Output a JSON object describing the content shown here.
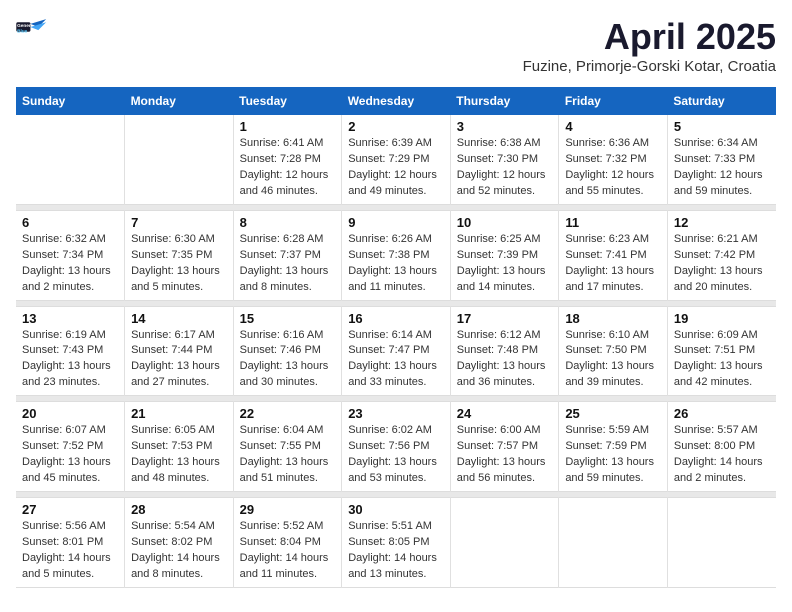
{
  "logo": {
    "line1": "General",
    "line2": "Blue"
  },
  "title": "April 2025",
  "subtitle": "Fuzine, Primorje-Gorski Kotar, Croatia",
  "days_of_week": [
    "Sunday",
    "Monday",
    "Tuesday",
    "Wednesday",
    "Thursday",
    "Friday",
    "Saturday"
  ],
  "weeks": [
    {
      "cells": [
        {
          "day": "",
          "content": ""
        },
        {
          "day": "",
          "content": ""
        },
        {
          "day": "1",
          "content": "Sunrise: 6:41 AM\nSunset: 7:28 PM\nDaylight: 12 hours\nand 46 minutes."
        },
        {
          "day": "2",
          "content": "Sunrise: 6:39 AM\nSunset: 7:29 PM\nDaylight: 12 hours\nand 49 minutes."
        },
        {
          "day": "3",
          "content": "Sunrise: 6:38 AM\nSunset: 7:30 PM\nDaylight: 12 hours\nand 52 minutes."
        },
        {
          "day": "4",
          "content": "Sunrise: 6:36 AM\nSunset: 7:32 PM\nDaylight: 12 hours\nand 55 minutes."
        },
        {
          "day": "5",
          "content": "Sunrise: 6:34 AM\nSunset: 7:33 PM\nDaylight: 12 hours\nand 59 minutes."
        }
      ]
    },
    {
      "cells": [
        {
          "day": "6",
          "content": "Sunrise: 6:32 AM\nSunset: 7:34 PM\nDaylight: 13 hours\nand 2 minutes."
        },
        {
          "day": "7",
          "content": "Sunrise: 6:30 AM\nSunset: 7:35 PM\nDaylight: 13 hours\nand 5 minutes."
        },
        {
          "day": "8",
          "content": "Sunrise: 6:28 AM\nSunset: 7:37 PM\nDaylight: 13 hours\nand 8 minutes."
        },
        {
          "day": "9",
          "content": "Sunrise: 6:26 AM\nSunset: 7:38 PM\nDaylight: 13 hours\nand 11 minutes."
        },
        {
          "day": "10",
          "content": "Sunrise: 6:25 AM\nSunset: 7:39 PM\nDaylight: 13 hours\nand 14 minutes."
        },
        {
          "day": "11",
          "content": "Sunrise: 6:23 AM\nSunset: 7:41 PM\nDaylight: 13 hours\nand 17 minutes."
        },
        {
          "day": "12",
          "content": "Sunrise: 6:21 AM\nSunset: 7:42 PM\nDaylight: 13 hours\nand 20 minutes."
        }
      ]
    },
    {
      "cells": [
        {
          "day": "13",
          "content": "Sunrise: 6:19 AM\nSunset: 7:43 PM\nDaylight: 13 hours\nand 23 minutes."
        },
        {
          "day": "14",
          "content": "Sunrise: 6:17 AM\nSunset: 7:44 PM\nDaylight: 13 hours\nand 27 minutes."
        },
        {
          "day": "15",
          "content": "Sunrise: 6:16 AM\nSunset: 7:46 PM\nDaylight: 13 hours\nand 30 minutes."
        },
        {
          "day": "16",
          "content": "Sunrise: 6:14 AM\nSunset: 7:47 PM\nDaylight: 13 hours\nand 33 minutes."
        },
        {
          "day": "17",
          "content": "Sunrise: 6:12 AM\nSunset: 7:48 PM\nDaylight: 13 hours\nand 36 minutes."
        },
        {
          "day": "18",
          "content": "Sunrise: 6:10 AM\nSunset: 7:50 PM\nDaylight: 13 hours\nand 39 minutes."
        },
        {
          "day": "19",
          "content": "Sunrise: 6:09 AM\nSunset: 7:51 PM\nDaylight: 13 hours\nand 42 minutes."
        }
      ]
    },
    {
      "cells": [
        {
          "day": "20",
          "content": "Sunrise: 6:07 AM\nSunset: 7:52 PM\nDaylight: 13 hours\nand 45 minutes."
        },
        {
          "day": "21",
          "content": "Sunrise: 6:05 AM\nSunset: 7:53 PM\nDaylight: 13 hours\nand 48 minutes."
        },
        {
          "day": "22",
          "content": "Sunrise: 6:04 AM\nSunset: 7:55 PM\nDaylight: 13 hours\nand 51 minutes."
        },
        {
          "day": "23",
          "content": "Sunrise: 6:02 AM\nSunset: 7:56 PM\nDaylight: 13 hours\nand 53 minutes."
        },
        {
          "day": "24",
          "content": "Sunrise: 6:00 AM\nSunset: 7:57 PM\nDaylight: 13 hours\nand 56 minutes."
        },
        {
          "day": "25",
          "content": "Sunrise: 5:59 AM\nSunset: 7:59 PM\nDaylight: 13 hours\nand 59 minutes."
        },
        {
          "day": "26",
          "content": "Sunrise: 5:57 AM\nSunset: 8:00 PM\nDaylight: 14 hours\nand 2 minutes."
        }
      ]
    },
    {
      "cells": [
        {
          "day": "27",
          "content": "Sunrise: 5:56 AM\nSunset: 8:01 PM\nDaylight: 14 hours\nand 5 minutes."
        },
        {
          "day": "28",
          "content": "Sunrise: 5:54 AM\nSunset: 8:02 PM\nDaylight: 14 hours\nand 8 minutes."
        },
        {
          "day": "29",
          "content": "Sunrise: 5:52 AM\nSunset: 8:04 PM\nDaylight: 14 hours\nand 11 minutes."
        },
        {
          "day": "30",
          "content": "Sunrise: 5:51 AM\nSunset: 8:05 PM\nDaylight: 14 hours\nand 13 minutes."
        },
        {
          "day": "",
          "content": ""
        },
        {
          "day": "",
          "content": ""
        },
        {
          "day": "",
          "content": ""
        }
      ]
    }
  ]
}
